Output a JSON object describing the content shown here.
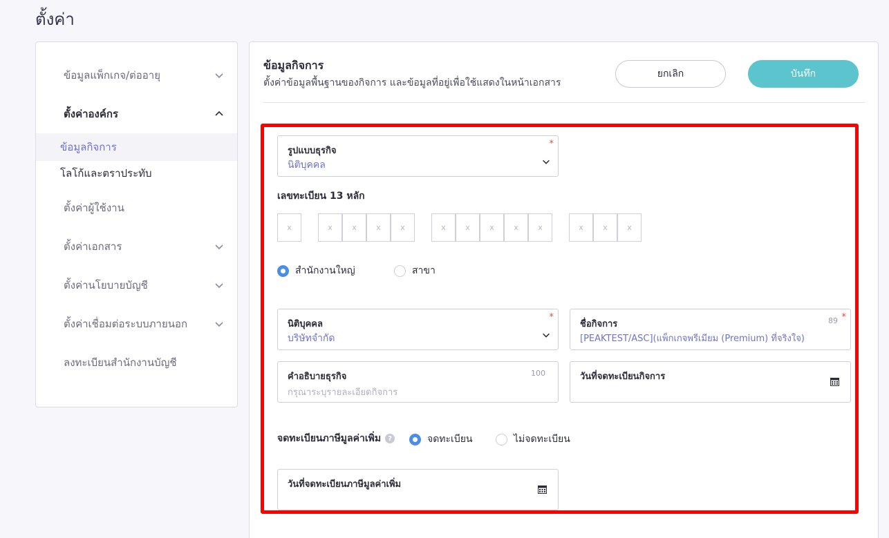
{
  "page": {
    "title": "ตั้งค่า"
  },
  "sidebar": {
    "items": [
      {
        "label": "ข้อมูลแพ็กเกจ/ต่ออายุ"
      },
      {
        "label": "ตั้งค่าองค์กร"
      },
      {
        "label": "ข้อมูลกิจการ"
      },
      {
        "label": "โลโก้และตราประทับ"
      },
      {
        "label": "ตั้งค่าผู้ใช้งาน"
      },
      {
        "label": "ตั้งค่าเอกสาร"
      },
      {
        "label": "ตั้งค่านโยบายบัญชี"
      },
      {
        "label": "ตั้งค่าเชื่อมต่อระบบภายนอก"
      },
      {
        "label": "ลงทะเบียนสำนักงานบัญชี"
      }
    ]
  },
  "main": {
    "title": "ข้อมูลกิจการ",
    "subtitle": "ตั้งค่าข้อมูลพื้นฐานของกิจการ และข้อมูลที่อยู่เพื่อใช้แสดงในหน้าเอกสาร",
    "cancel_label": "ยกเลิก",
    "save_label": "บันทึก"
  },
  "form": {
    "business_type": {
      "label": "รูปแบบธุรกิจ",
      "value": "นิติบุคคล",
      "required": "*"
    },
    "registration": {
      "label": "เลขทะเบียน 13 หลัก",
      "digit_placeholder": "x"
    },
    "branch": {
      "head_office": "สำนักงานใหญ่",
      "branch": "สาขา"
    },
    "entity": {
      "label": "นิติบุคคล",
      "value": "บริษัทจำกัด",
      "required": "*"
    },
    "business_name": {
      "label": "ชื่อกิจการ",
      "value": "[PEAKTEST/ASC](แพ็กเกจพรีเมียม (Premium) ที่จริงใจ)",
      "count": "89",
      "required": "*"
    },
    "description": {
      "label": "คำอธิบายธุรกิจ",
      "placeholder": "กรุณาระบุรายละเอียดกิจการ",
      "count": "100"
    },
    "registered_date": {
      "label": "วันที่จดทะเบียนกิจการ"
    },
    "vat": {
      "label": "จดทะเบียนภาษีมูลค่าเพิ่ม",
      "help": "?",
      "registered": "จดทะเบียน",
      "not_registered": "ไม่จดทะเบียน"
    },
    "vat_date": {
      "label": "วันที่จดทะเบียนภาษีมูลค่าเพิ่ม"
    }
  },
  "colors": {
    "accent": "#5bc4cc",
    "link": "#6f73c9",
    "radio_on": "#4c8ee6",
    "highlight": "#ff0000"
  }
}
